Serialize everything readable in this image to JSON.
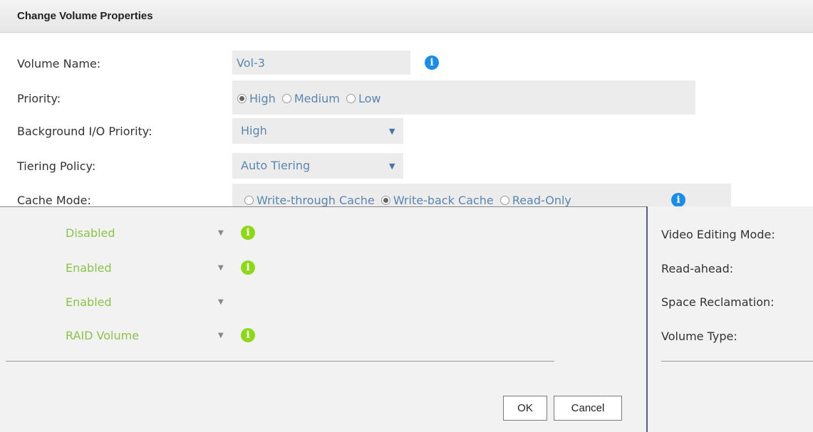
{
  "dialog": {
    "title": "Change Volume Properties"
  },
  "form": {
    "volume_name": {
      "label": "Volume Name:",
      "value": "Vol-3"
    },
    "priority": {
      "label": "Priority:",
      "options": [
        "High",
        "Medium",
        "Low"
      ],
      "selected": "High"
    },
    "background_io": {
      "label": "Background I/O Priority:",
      "value": "High"
    },
    "tiering_policy": {
      "label": "Tiering Policy:",
      "value": "Auto Tiering"
    },
    "cache_mode": {
      "label": "Cache Mode:",
      "options": [
        "Write-through Cache",
        "Write-back Cache",
        "Read-Only"
      ],
      "selected": "Write-back Cache"
    }
  },
  "overlay": {
    "values": [
      "Disabled",
      "Enabled",
      "Enabled",
      "RAID Volume"
    ],
    "labels": [
      "Video Editing Mode:",
      "Read-ahead:",
      "Space Reclamation:",
      "Volume Type:"
    ]
  },
  "buttons": {
    "ok": "OK",
    "cancel": "Cancel"
  },
  "colors": {
    "accent_blue": "#1a8de8",
    "accent_green": "#8ed81a",
    "value_blue": "#5b86b0",
    "value_green": "#8bc34a"
  },
  "icons": {
    "info": "info-icon",
    "dropdown": "chevron-down-icon"
  }
}
